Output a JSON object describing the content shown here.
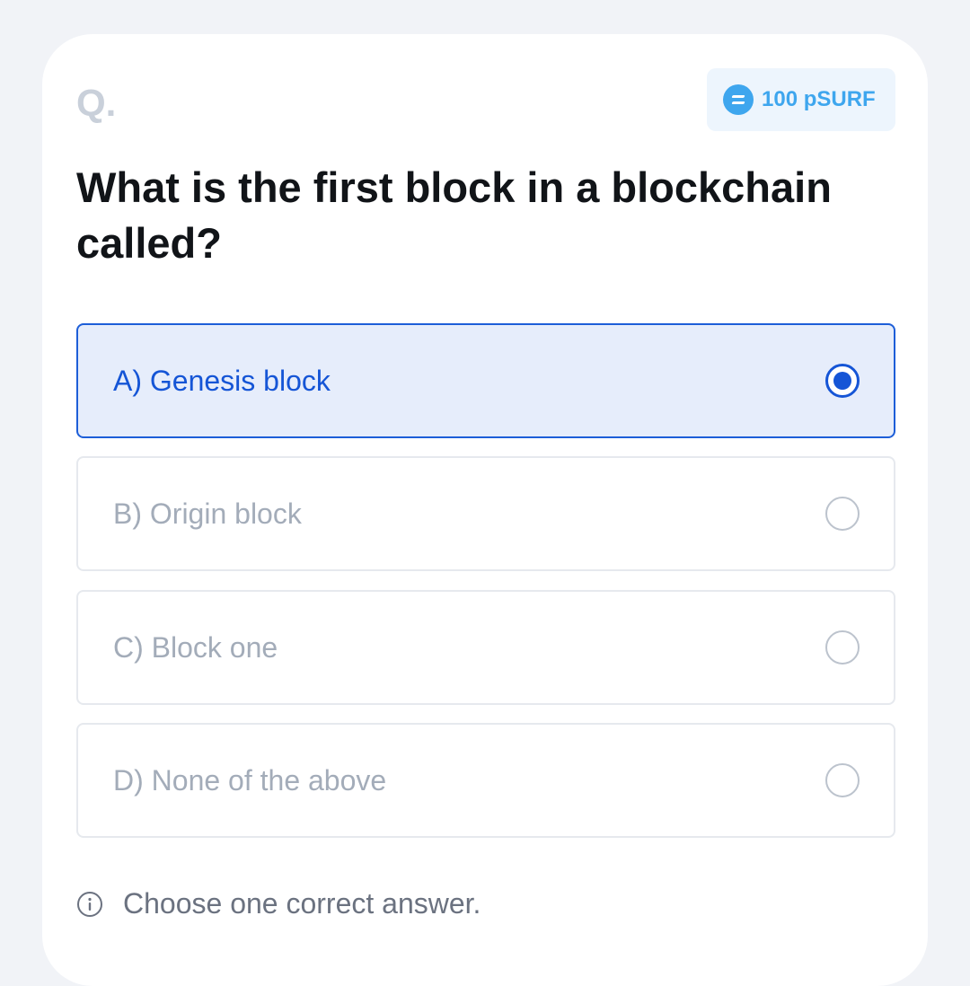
{
  "question_card": {
    "q_label": "Q.",
    "reward": {
      "icon": "coin-icon",
      "text": "100 pSURF",
      "color": "#3ea6ee"
    },
    "question": "What is the first block in a blockchain called?",
    "options": [
      {
        "label": "A) Genesis block",
        "selected": true
      },
      {
        "label": "B) Origin block",
        "selected": false
      },
      {
        "label": "C) Block one",
        "selected": false
      },
      {
        "label": "D) None of the above",
        "selected": false
      }
    ],
    "hint": {
      "icon": "info-icon",
      "text": "Choose one correct answer."
    }
  },
  "colors": {
    "accent": "#1555d6",
    "selected_bg": "#e6edfb",
    "muted_text": "#a3acb9",
    "page_bg": "#f1f3f7"
  }
}
